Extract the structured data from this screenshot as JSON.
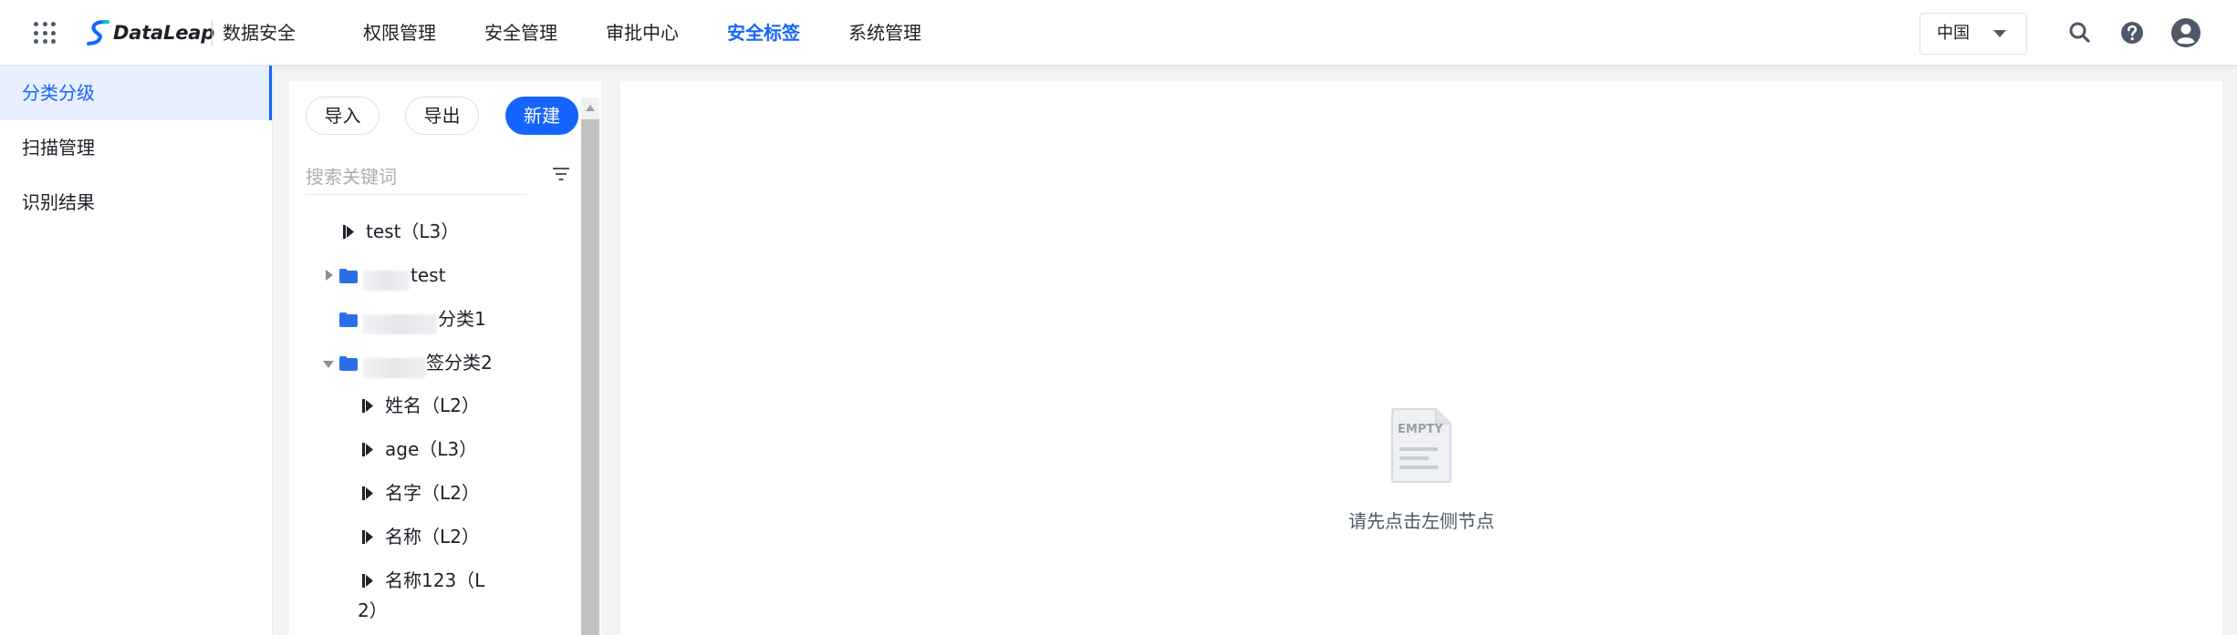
{
  "header": {
    "brand": "DataLeap",
    "product": "数据安全",
    "nav": [
      {
        "label": "权限管理",
        "active": false
      },
      {
        "label": "安全管理",
        "active": false
      },
      {
        "label": "审批中心",
        "active": false
      },
      {
        "label": "安全标签",
        "active": true
      },
      {
        "label": "系统管理",
        "active": false
      }
    ],
    "region": "中国",
    "icons": [
      "apps-grid-icon",
      "search-icon",
      "help-icon",
      "user-avatar-icon"
    ]
  },
  "sidebar": {
    "items": [
      {
        "label": "分类分级",
        "active": true
      },
      {
        "label": "扫描管理",
        "active": false
      },
      {
        "label": "识别结果",
        "active": false
      }
    ]
  },
  "panel": {
    "import_label": "导入",
    "export_label": "导出",
    "new_label": "新建",
    "search_placeholder": "搜索关键词",
    "tree": [
      {
        "type": "tag",
        "label": "test（L3）"
      },
      {
        "type": "folder",
        "label": "test",
        "expanded": false
      },
      {
        "type": "folder",
        "label": "分类1"
      },
      {
        "type": "folder",
        "label": "签分类2",
        "expanded": true
      },
      {
        "type": "tag",
        "label": "姓名（L2）"
      },
      {
        "type": "tag",
        "label": "age（L3）"
      },
      {
        "type": "tag",
        "label": "名字（L2）"
      },
      {
        "type": "tag",
        "label": "名称（L2）"
      },
      {
        "type": "tag",
        "label_line1": "名称123（L",
        "label_line2": "2）"
      }
    ]
  },
  "content": {
    "empty_image_text": "EMPTY",
    "empty_hint": "请先点击左侧节点"
  },
  "colors": {
    "accent": "#1664ff",
    "folder": "#2b6fe8",
    "active_bg": "#e8f0ff"
  }
}
